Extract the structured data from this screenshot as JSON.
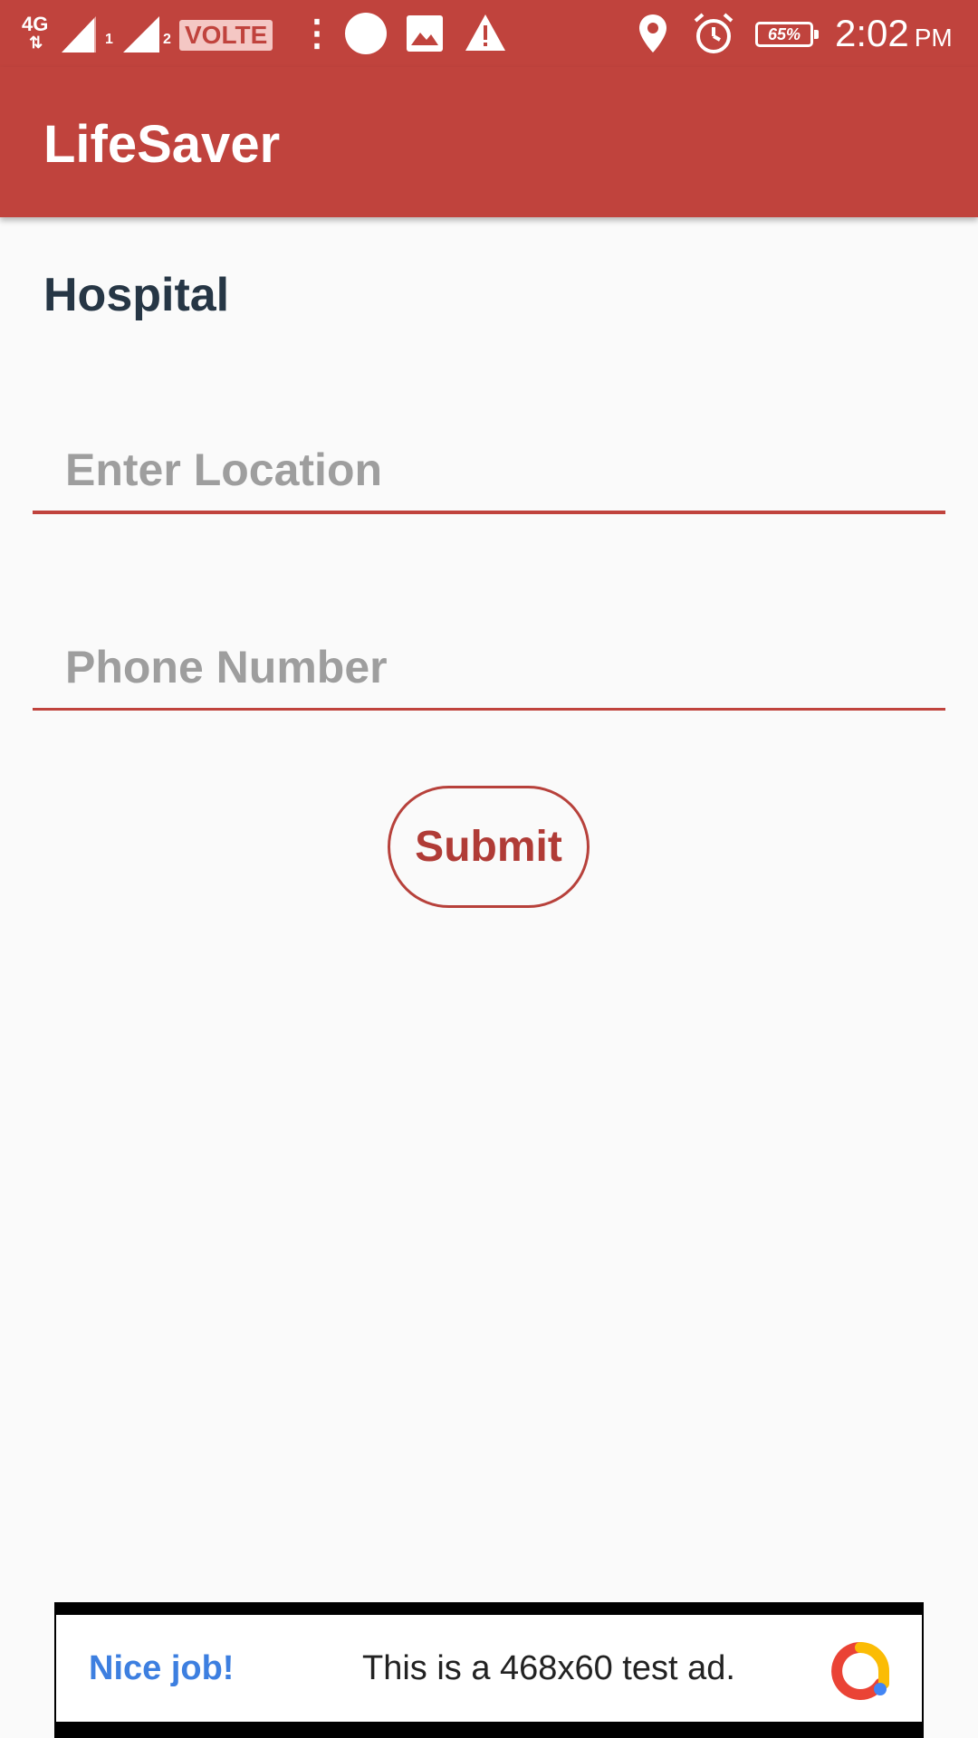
{
  "status_bar": {
    "network": "4G",
    "sim1": "1",
    "sim2": "2",
    "volte": "VOLTE",
    "more": "⋮",
    "battery": "65%",
    "time": "2:02",
    "ampm": "PM"
  },
  "app_bar": {
    "title": "LifeSaver"
  },
  "form": {
    "heading": "Hospital",
    "location_placeholder": "Enter Location",
    "location_value": "",
    "phone_placeholder": "Phone Number",
    "phone_value": "",
    "submit_label": "Submit"
  },
  "ad": {
    "nice": "Nice job!",
    "text": "This is a 468x60 test ad.",
    "logo_icon": "google-ads-logo-icon"
  },
  "colors": {
    "primary": "#c0433d",
    "accent_text": "#b03b36",
    "heading": "#263645",
    "placeholder": "#9e9e9e",
    "ad_link": "#3d7fe0"
  },
  "icons": [
    "signal-icon",
    "signal-icon",
    "circle-icon",
    "image-icon",
    "warning-icon",
    "location-pin-icon",
    "alarm-icon",
    "battery-icon"
  ]
}
